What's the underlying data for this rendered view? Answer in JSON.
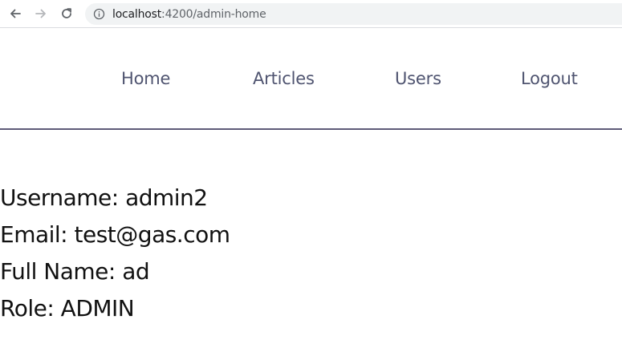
{
  "browser": {
    "url_host": "localhost",
    "url_path": ":4200/admin-home"
  },
  "nav": {
    "items": [
      {
        "label": "Home"
      },
      {
        "label": "Articles"
      },
      {
        "label": "Users"
      },
      {
        "label": "Logout"
      }
    ]
  },
  "profile": {
    "username": "Username: admin2",
    "email": "Email: test@gas.com",
    "full_name": "Full Name: ad",
    "role": "Role: ADMIN"
  },
  "colors": {
    "nav_text": "#4f5470",
    "divider": "#5e5b78",
    "body_text": "#111111"
  },
  "icons": {
    "back": "arrow-left-icon",
    "forward": "arrow-right-icon",
    "reload": "reload-icon",
    "info": "info-icon"
  }
}
